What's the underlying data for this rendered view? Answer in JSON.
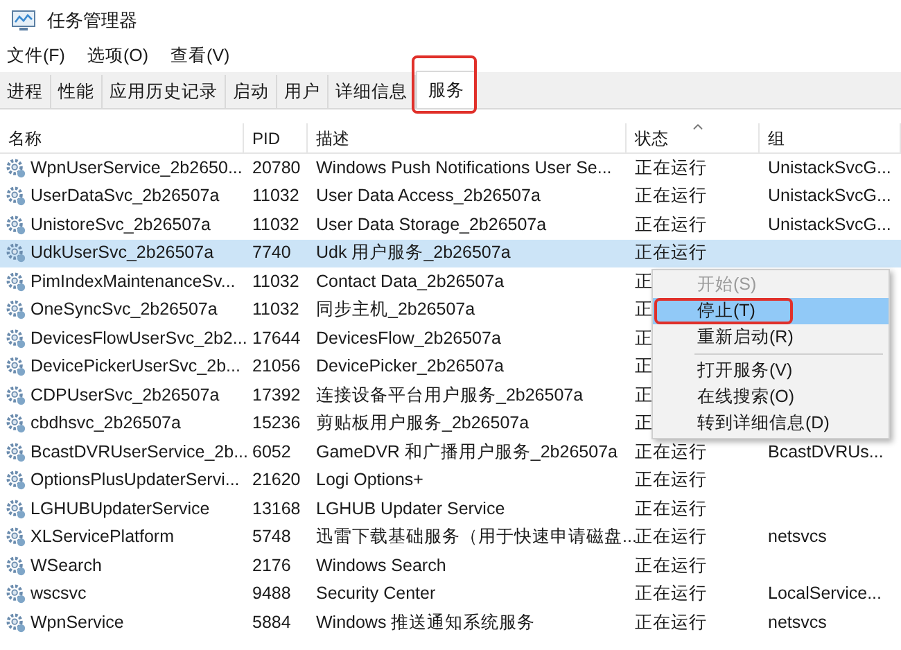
{
  "window": {
    "title": "任务管理器"
  },
  "menu_bar": [
    "文件(F)",
    "选项(O)",
    "查看(V)"
  ],
  "tabs": [
    {
      "label": "进程",
      "selected": false
    },
    {
      "label": "性能",
      "selected": false
    },
    {
      "label": "应用历史记录",
      "selected": false
    },
    {
      "label": "启动",
      "selected": false
    },
    {
      "label": "用户",
      "selected": false
    },
    {
      "label": "详细信息",
      "selected": false
    },
    {
      "label": "服务",
      "selected": true,
      "highlighted": true
    }
  ],
  "table": {
    "columns": [
      {
        "label": "名称",
        "sorted": false
      },
      {
        "label": "PID",
        "sorted": false
      },
      {
        "label": "描述",
        "sorted": false
      },
      {
        "label": "状态",
        "sorted": true
      },
      {
        "label": "组",
        "sorted": false
      }
    ],
    "rows": [
      {
        "name": "WpnUserService_2b2650...",
        "pid": "20780",
        "description": "Windows Push Notifications User Se...",
        "status": "正在运行",
        "group": "UnistackSvcG...",
        "selected": false
      },
      {
        "name": "UserDataSvc_2b26507a",
        "pid": "11032",
        "description": "User Data Access_2b26507a",
        "status": "正在运行",
        "group": "UnistackSvcG...",
        "selected": false
      },
      {
        "name": "UnistoreSvc_2b26507a",
        "pid": "11032",
        "description": "User Data Storage_2b26507a",
        "status": "正在运行",
        "group": "UnistackSvcG...",
        "selected": false
      },
      {
        "name": "UdkUserSvc_2b26507a",
        "pid": "7740",
        "description": "Udk 用户服务_2b26507a",
        "status": "正在运行",
        "selected": true
      },
      {
        "name": "PimIndexMaintenanceSv...",
        "pid": "11032",
        "description": "Contact Data_2b26507a",
        "status": "正",
        "selected": false
      },
      {
        "name": "OneSyncSvc_2b26507a",
        "pid": "11032",
        "description": "同步主机_2b26507a",
        "status": "正",
        "selected": false
      },
      {
        "name": "DevicesFlowUserSvc_2b2...",
        "pid": "17644",
        "description": "DevicesFlow_2b26507a",
        "status": "正",
        "selected": false
      },
      {
        "name": "DevicePickerUserSvc_2b...",
        "pid": "21056",
        "description": "DevicePicker_2b26507a",
        "status": "正",
        "selected": false
      },
      {
        "name": "CDPUserSvc_2b26507a",
        "pid": "17392",
        "description": "连接设备平台用户服务_2b26507a",
        "status": "正",
        "selected": false
      },
      {
        "name": "cbdhsvc_2b26507a",
        "pid": "15236",
        "description": "剪贴板用户服务_2b26507a",
        "status": "正",
        "selected": false
      },
      {
        "name": "BcastDVRUserService_2b...",
        "pid": "6052",
        "description": "GameDVR 和广播用户服务_2b26507a",
        "status": "正在运行",
        "group": "BcastDVRUs...",
        "selected": false
      },
      {
        "name": "OptionsPlusUpdaterServi...",
        "pid": "21620",
        "description": "Logi Options+",
        "status": "正在运行",
        "selected": false
      },
      {
        "name": "LGHUBUpdaterService",
        "pid": "13168",
        "description": "LGHUB Updater Service",
        "status": "正在运行",
        "selected": false
      },
      {
        "name": "XLServicePlatform",
        "pid": "5748",
        "description": "迅雷下载基础服务（用于快速申请磁盘...",
        "status": "正在运行",
        "group": "netsvcs",
        "selected": false
      },
      {
        "name": "WSearch",
        "pid": "2176",
        "description": "Windows Search",
        "status": "正在运行",
        "selected": false
      },
      {
        "name": "wscsvc",
        "pid": "9488",
        "description": "Security Center",
        "status": "正在运行",
        "group": "LocalService...",
        "selected": false
      },
      {
        "name": "WpnService",
        "pid": "5884",
        "description": "Windows 推送通知系统服务",
        "status": "正在运行",
        "group": "netsvcs",
        "selected": false
      }
    ]
  },
  "context_menu": [
    {
      "kind": "item",
      "label": "开始(S)",
      "disabled": true,
      "selected": false
    },
    {
      "kind": "item",
      "label": "停止(T)",
      "disabled": false,
      "selected": true,
      "highlighted": true
    },
    {
      "kind": "item",
      "label": "重新启动(R)",
      "disabled": false,
      "selected": false
    },
    {
      "kind": "separator"
    },
    {
      "kind": "item",
      "label": "打开服务(V)",
      "disabled": false,
      "selected": false
    },
    {
      "kind": "item",
      "label": "在线搜索(O)",
      "disabled": false,
      "selected": false
    },
    {
      "kind": "item",
      "label": "转到详细信息(D)",
      "disabled": false,
      "selected": false
    }
  ]
}
